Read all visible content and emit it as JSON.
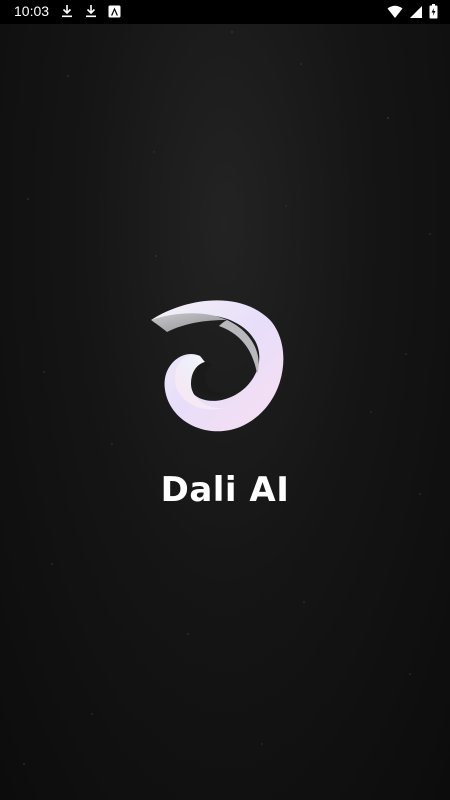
{
  "status_bar": {
    "time": "10:03",
    "left_icons": [
      "download-icon",
      "download-icon",
      "app-notification-icon"
    ],
    "right_icons": [
      "wifi-icon",
      "signal-icon",
      "battery-icon"
    ]
  },
  "splash": {
    "app_name": "Dali AI",
    "logo": "dali-ai-logo"
  },
  "colors": {
    "background": "#141414",
    "status_bar": "#000000",
    "text": "#ffffff"
  }
}
